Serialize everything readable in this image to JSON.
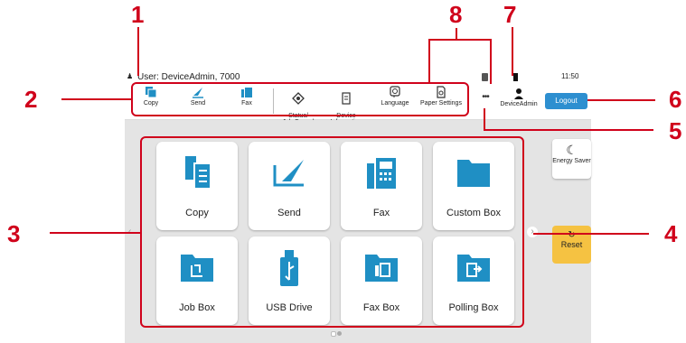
{
  "status_bar": {
    "user": "User: DeviceAdmin, 7000",
    "time": "11:50"
  },
  "toolbar": {
    "items": [
      {
        "label": "Copy",
        "icon": "copy-icon"
      },
      {
        "label": "Send",
        "icon": "send-icon"
      },
      {
        "label": "Fax",
        "icon": "fax-icon"
      },
      {
        "label": "Status/\nJob Cancel",
        "icon": "status-icon"
      },
      {
        "label": "Device\nInformation",
        "icon": "device-info-icon"
      },
      {
        "label": "Language",
        "icon": "language-icon"
      },
      {
        "label": "Paper Settings",
        "icon": "paper-settings-icon"
      }
    ],
    "more": "•••",
    "account_label": "DeviceAdmin",
    "logout_label": "Logout"
  },
  "side": {
    "energy_saver": "Energy Saver",
    "reset": "Reset"
  },
  "tiles": [
    {
      "label": "Copy",
      "icon": "copy-icon"
    },
    {
      "label": "Send",
      "icon": "send-icon"
    },
    {
      "label": "Fax",
      "icon": "fax-icon"
    },
    {
      "label": "Custom Box",
      "icon": "folder-icon"
    },
    {
      "label": "Job Box",
      "icon": "job-box-icon"
    },
    {
      "label": "USB Drive",
      "icon": "usb-drive-icon"
    },
    {
      "label": "Fax Box",
      "icon": "fax-box-icon"
    },
    {
      "label": "Polling Box",
      "icon": "polling-box-icon"
    }
  ],
  "callouts": [
    "1",
    "2",
    "3",
    "4",
    "5",
    "6",
    "7",
    "8"
  ],
  "colors": {
    "accent": "#1f8fc4",
    "callout": "#d0021b",
    "reset": "#f5c242",
    "logout": "#2d8fd0"
  }
}
